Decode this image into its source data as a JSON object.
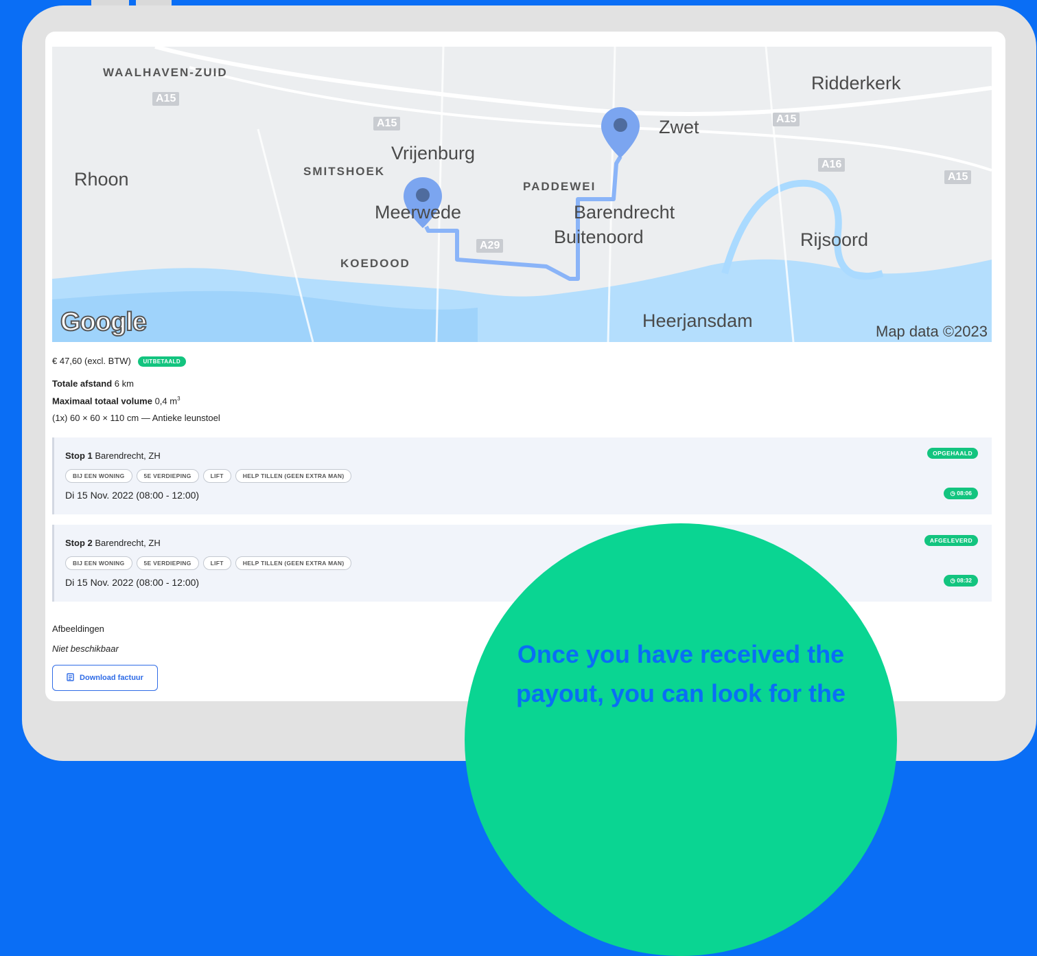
{
  "map": {
    "labels": {
      "waalhaven": "WAALHAVEN-ZUID",
      "ridderkerk": "Ridderkerk",
      "zwet": "Zwet",
      "vrijenburg": "Vrijenburg",
      "smitshoek": "SMITSHOEK",
      "rhoon": "Rhoon",
      "paddewei": "PADDEWEI",
      "meerwede": "Meerwede",
      "barendrecht": "Barendrecht",
      "buitenoord": "Buitenoord",
      "rijsoord": "Rijsoord",
      "koedood": "KOEDOOD",
      "heerjansdam": "Heerjansdam"
    },
    "shields": {
      "a15_1": "A15",
      "a15_2": "A15",
      "a15_3": "A15",
      "a15_4": "A15",
      "a16": "A16",
      "a29": "A29"
    },
    "logo": "Google",
    "credit": "Map data ©2023",
    "route_color": "#8ab4f8",
    "pin_color": "#7ba5f0"
  },
  "order": {
    "price": "€ 47,60 (excl. BTW)",
    "paid_badge": "UITBETAALD",
    "distance_label": "Totale afstand",
    "distance_value": "6 km",
    "volume_label": "Maximaal totaal volume",
    "volume_value": "0,4 m",
    "volume_unit_sup": "3",
    "item": "(1x) 60 × 60 × 110 cm — Antieke leunstoel"
  },
  "stops": [
    {
      "label": "Stop 1",
      "place": "Barendrecht, ZH",
      "tags": [
        "BIJ EEN WONING",
        "5E VERDIEPING",
        "LIFT",
        "HELP TILLEN (GEEN EXTRA MAN)"
      ],
      "date": "Di 15 Nov. 2022 (08:00 - 12:00)",
      "status": "OPGEHAALD",
      "time": "08:06"
    },
    {
      "label": "Stop 2",
      "place": "Barendrecht, ZH",
      "tags": [
        "BIJ EEN WONING",
        "5E VERDIEPING",
        "LIFT",
        "HELP TILLEN (GEEN EXTRA MAN)"
      ],
      "date": "Di 15 Nov. 2022 (08:00 - 12:00)",
      "status": "AFGELEVERD",
      "time": "08:32"
    }
  ],
  "images": {
    "title": "Afbeeldingen",
    "value": "Niet beschikbaar"
  },
  "download_label": "Download factuur",
  "callout": {
    "line1": "Once you have received the",
    "line2": "payout, you can look for the"
  },
  "colors": {
    "background": "#0a6ef5",
    "success": "#13c47f",
    "bubble": "#0ad592",
    "button": "#2e6be6"
  }
}
